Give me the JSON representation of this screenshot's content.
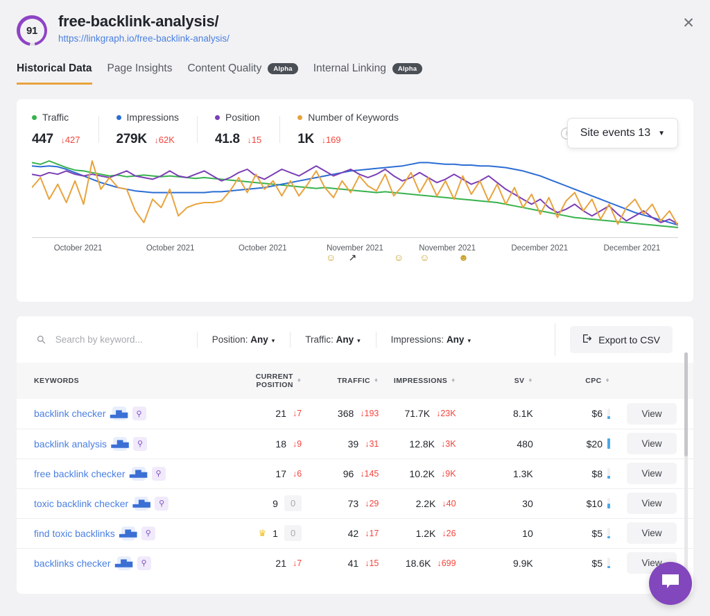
{
  "header": {
    "score": "91",
    "title": "free-backlink-analysis/",
    "url": "https://linkgraph.io/free-backlink-analysis/",
    "close_label": "✕"
  },
  "tabs": [
    {
      "label": "Historical Data",
      "badge": "",
      "active": true
    },
    {
      "label": "Page Insights",
      "badge": "",
      "active": false
    },
    {
      "label": "Content Quality",
      "badge": "Alpha",
      "active": false
    },
    {
      "label": "Internal Linking",
      "badge": "Alpha",
      "active": false
    }
  ],
  "metrics": [
    {
      "label": "Traffic",
      "value": "447",
      "delta": "427",
      "arrow": "↓",
      "color": "#37b24d"
    },
    {
      "label": "Impressions",
      "value": "279K",
      "delta": "62K",
      "arrow": "↓",
      "color": "#2b6cd4"
    },
    {
      "label": "Position",
      "value": "41.8",
      "delta": "15",
      "arrow": "↓",
      "color": "#7b3fb5"
    },
    {
      "label": "Number of Keywords",
      "value": "1K",
      "delta": "169",
      "arrow": "↓",
      "color": "#e8a33d"
    }
  ],
  "site_events": {
    "label": "Site events 13",
    "caret": "▼",
    "info": "i"
  },
  "chart_data": {
    "type": "line",
    "title": "",
    "xlabel": "",
    "ylabel": "",
    "grid": false,
    "legend": "top",
    "x_tick_labels": [
      "October 2021",
      "October 2021",
      "October 2021",
      "November 2021",
      "November 2021",
      "December 2021",
      "December 2021"
    ],
    "series": [
      {
        "name": "Traffic",
        "color": "#37b24d",
        "values": [
          88,
          86,
          90,
          86,
          82,
          79,
          78,
          76,
          74,
          72,
          73,
          71,
          72,
          73,
          72,
          71,
          72,
          71,
          70,
          69,
          70,
          69,
          68,
          67,
          66,
          65,
          64,
          63,
          62,
          61,
          60,
          59,
          58,
          57,
          58,
          57,
          56,
          55,
          54,
          53,
          52,
          53,
          52,
          51,
          50,
          49,
          48,
          47,
          46,
          45,
          44,
          43,
          42,
          41,
          40,
          38,
          36,
          34,
          32,
          30,
          28,
          26,
          24,
          22,
          21,
          20,
          19,
          18,
          17,
          16,
          15,
          14,
          13,
          12,
          11,
          10
        ]
      },
      {
        "name": "Impressions",
        "color": "#2b6cd4",
        "values": [
          84,
          83,
          84,
          83,
          80,
          76,
          72,
          68,
          64,
          61,
          58,
          56,
          54,
          53,
          52,
          52,
          52,
          52,
          52,
          52,
          52,
          53,
          53,
          54,
          55,
          56,
          57,
          58,
          60,
          62,
          64,
          66,
          68,
          70,
          72,
          74,
          76,
          78,
          79,
          80,
          81,
          82,
          83,
          84,
          86,
          88,
          88,
          87,
          86,
          86,
          85,
          85,
          84,
          84,
          83,
          82,
          80,
          78,
          75,
          72,
          68,
          64,
          60,
          56,
          52,
          48,
          44,
          40,
          36,
          32,
          28,
          25,
          22,
          19,
          16,
          13
        ]
      },
      {
        "name": "Position",
        "color": "#7b3fb5",
        "values": [
          74,
          72,
          76,
          74,
          78,
          74,
          72,
          74,
          72,
          70,
          74,
          78,
          72,
          70,
          68,
          72,
          78,
          72,
          70,
          74,
          78,
          72,
          66,
          70,
          76,
          80,
          72,
          68,
          74,
          80,
          76,
          72,
          78,
          84,
          78,
          72,
          76,
          80,
          74,
          70,
          74,
          80,
          72,
          66,
          70,
          76,
          70,
          64,
          68,
          74,
          68,
          62,
          66,
          72,
          64,
          56,
          50,
          44,
          38,
          44,
          34,
          28,
          32,
          38,
          30,
          24,
          30,
          36,
          26,
          18,
          24,
          30,
          22,
          16,
          20,
          14
        ]
      },
      {
        "name": "Number of Keywords",
        "color": "#e8a33d",
        "values": [
          58,
          70,
          44,
          62,
          40,
          66,
          38,
          90,
          56,
          70,
          58,
          56,
          30,
          16,
          44,
          34,
          56,
          24,
          34,
          38,
          40,
          40,
          42,
          54,
          70,
          52,
          74,
          56,
          66,
          48,
          66,
          48,
          62,
          78,
          58,
          46,
          66,
          52,
          72,
          60,
          54,
          74,
          48,
          60,
          76,
          52,
          70,
          48,
          66,
          44,
          72,
          50,
          66,
          42,
          62,
          38,
          58,
          34,
          50,
          26,
          46,
          22,
          42,
          52,
          30,
          44,
          20,
          38,
          14,
          34,
          44,
          26,
          38,
          18,
          30,
          12
        ]
      }
    ],
    "event_markers": [
      {
        "glyph": "☺",
        "x_pct": 45.5,
        "color": "#c9a227"
      },
      {
        "glyph": "↗",
        "x_pct": 49.0,
        "color": "#21252b"
      },
      {
        "glyph": "☺",
        "x_pct": 56.0,
        "color": "#c9a227"
      },
      {
        "glyph": "☺",
        "x_pct": 60.0,
        "color": "#c9a227"
      },
      {
        "glyph": "☻",
        "x_pct": 66.0,
        "color": "#c9a227"
      }
    ]
  },
  "filters": {
    "search_placeholder": "Search by keyword...",
    "search_value": "",
    "search_icon": "⚲",
    "items": [
      {
        "label": "Position:",
        "value": "Any"
      },
      {
        "label": "Traffic:",
        "value": "Any"
      },
      {
        "label": "Impressions:",
        "value": "Any"
      }
    ],
    "export_label": "Export to CSV",
    "caret": "▾"
  },
  "table": {
    "columns": [
      {
        "label": "KEYWORDS",
        "sortable": false
      },
      {
        "label": "CURRENT POSITION",
        "sortable": true
      },
      {
        "label": "TRAFFIC",
        "sortable": true
      },
      {
        "label": "IMPRESSIONS",
        "sortable": true
      },
      {
        "label": "SV",
        "sortable": true
      },
      {
        "label": "CPC",
        "sortable": true
      },
      {
        "label": "",
        "sortable": false
      }
    ],
    "view_label": "View",
    "rows": [
      {
        "keyword": "backlink checker",
        "position": "21",
        "position_delta": "7",
        "position_zero": false,
        "crown": false,
        "traffic": "368",
        "traffic_delta": "193",
        "impressions": "71.7K",
        "impressions_delta": "23K",
        "sv": "8.1K",
        "cpc": "$6",
        "cpc_pct": 25
      },
      {
        "keyword": "backlink analysis",
        "position": "18",
        "position_delta": "9",
        "position_zero": false,
        "crown": false,
        "traffic": "39",
        "traffic_delta": "31",
        "impressions": "12.8K",
        "impressions_delta": "3K",
        "sv": "480",
        "cpc": "$20",
        "cpc_pct": 100
      },
      {
        "keyword": "free backlink checker",
        "position": "17",
        "position_delta": "6",
        "position_zero": false,
        "crown": false,
        "traffic": "96",
        "traffic_delta": "145",
        "impressions": "10.2K",
        "impressions_delta": "9K",
        "sv": "1.3K",
        "cpc": "$8",
        "cpc_pct": 30
      },
      {
        "keyword": "toxic backlink checker",
        "position": "9",
        "position_delta": "0",
        "position_zero": true,
        "crown": false,
        "traffic": "73",
        "traffic_delta": "29",
        "impressions": "2.2K",
        "impressions_delta": "40",
        "sv": "30",
        "cpc": "$10",
        "cpc_pct": 50
      },
      {
        "keyword": "find toxic backlinks",
        "position": "1",
        "position_delta": "0",
        "position_zero": true,
        "crown": true,
        "traffic": "42",
        "traffic_delta": "17",
        "impressions": "1.2K",
        "impressions_delta": "26",
        "sv": "10",
        "cpc": "$5",
        "cpc_pct": 22
      },
      {
        "keyword": "backlinks checker",
        "position": "21",
        "position_delta": "7",
        "position_zero": false,
        "crown": false,
        "traffic": "41",
        "traffic_delta": "15",
        "impressions": "18.6K",
        "impressions_delta": "699",
        "sv": "9.9K",
        "cpc": "$5",
        "cpc_pct": 22
      }
    ]
  },
  "chat": {
    "icon": "chat-bubble"
  }
}
